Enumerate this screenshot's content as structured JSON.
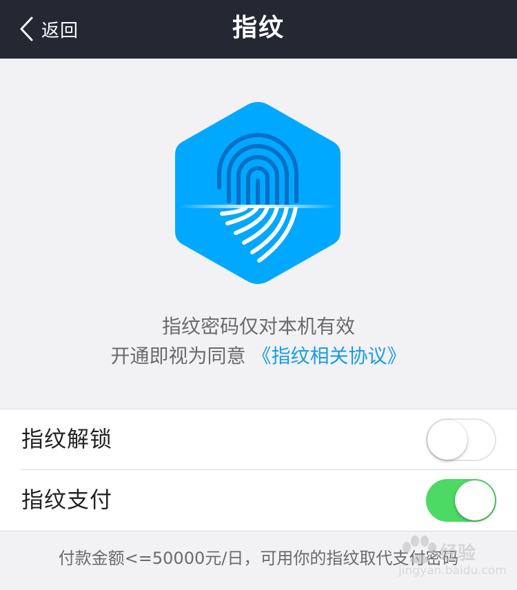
{
  "navbar": {
    "back_label": "返回",
    "title": "指纹"
  },
  "hero": {
    "icon": "fingerprint-hexagon-icon",
    "notice_line1": "指纹密码仅对本机有效",
    "notice_line2_prefix": "开通即视为同意 ",
    "agreement_link": "《指纹相关协议》"
  },
  "settings": [
    {
      "label": "指纹解锁",
      "enabled": false
    },
    {
      "label": "指纹支付",
      "enabled": true
    }
  ],
  "footer_note": "付款金额<=50000元/日，可用你的指纹取代支付密码",
  "watermark": {
    "text": "经验",
    "sub": "jingyan.baidu.com"
  },
  "colors": {
    "navbar_bg": "#242833",
    "icon_blue": "#00a8ff",
    "link_blue": "#1a9ce6",
    "toggle_on": "#4cd964",
    "page_bg": "#f2f2f5"
  }
}
